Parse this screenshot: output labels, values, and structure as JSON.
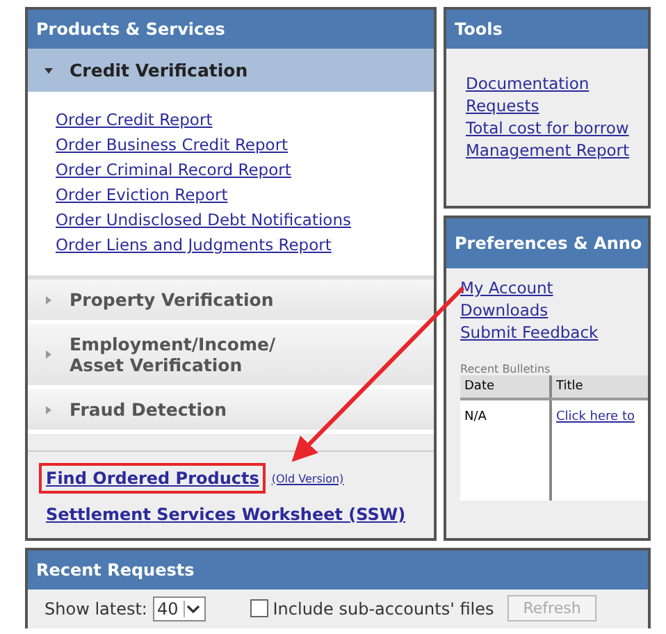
{
  "products_panel": {
    "title": "Products & Services",
    "sections": [
      {
        "label": "Credit Verification",
        "expanded": true,
        "links": [
          "Order Credit Report",
          "Order Business Credit Report",
          "Order Criminal Record Report",
          "Order Eviction Report",
          "Order Undisclosed Debt Notifications",
          "Order Liens and Judgments Report"
        ]
      },
      {
        "label": "Property Verification",
        "expanded": false
      },
      {
        "label": "Employment/Income/ Asset Verification",
        "expanded": false
      },
      {
        "label": "Fraud Detection",
        "expanded": false
      }
    ],
    "footer_links": [
      {
        "label": "Find Ordered Products",
        "highlighted": true,
        "note": "(Old Version)"
      },
      {
        "label": "Settlement Services Worksheet (SSW)",
        "highlighted": false
      }
    ]
  },
  "tools_panel": {
    "title": "Tools",
    "links": [
      "Documentation",
      "Requests",
      "Total cost for borrow",
      "Management Report"
    ]
  },
  "preferences_panel": {
    "title": "Preferences & Anno",
    "links": [
      "My Account",
      "Downloads",
      "Submit Feedback"
    ],
    "bulletins": {
      "label": "Recent Bulletins",
      "columns": [
        "Date",
        "Title"
      ],
      "rows": [
        [
          "N/A",
          "Click here to"
        ]
      ]
    }
  },
  "recent_requests": {
    "title": "Recent Requests",
    "show_latest_label": "Show latest:",
    "show_latest_value": "40",
    "include_checkbox": {
      "label": "Include sub-accounts' files",
      "checked": false
    },
    "refresh_button": {
      "label": "Refresh",
      "disabled": true
    }
  }
}
